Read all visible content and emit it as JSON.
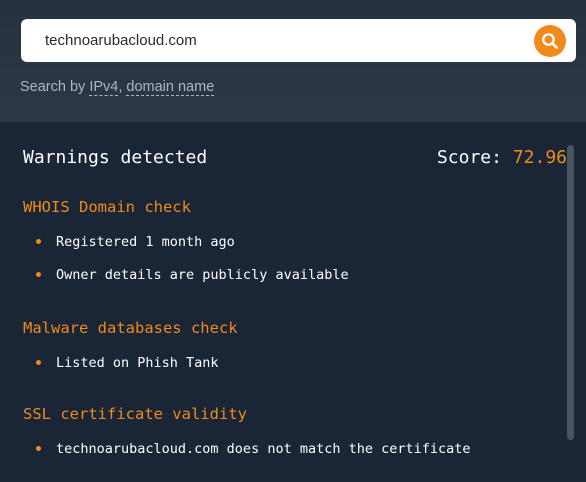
{
  "search": {
    "value": "technoarubacloud.com",
    "hint_prefix": "Search by",
    "hint_opt1": "IPv4",
    "hint_sep": ",",
    "hint_opt2": "domain name"
  },
  "result": {
    "title": "Warnings detected",
    "score_label": "Score:",
    "score_value": "72.96"
  },
  "sections": [
    {
      "heading": "WHOIS Domain check",
      "items": [
        "Registered 1 month ago",
        "Owner details are publicly available"
      ]
    },
    {
      "heading": "Malware databases check",
      "items": [
        "Listed on Phish Tank"
      ]
    },
    {
      "heading": "SSL certificate validity",
      "items": [
        "technoarubacloud.com does not match the certificate"
      ]
    }
  ],
  "colors": {
    "accent": "#f08a1c",
    "background": "#1a2535"
  }
}
